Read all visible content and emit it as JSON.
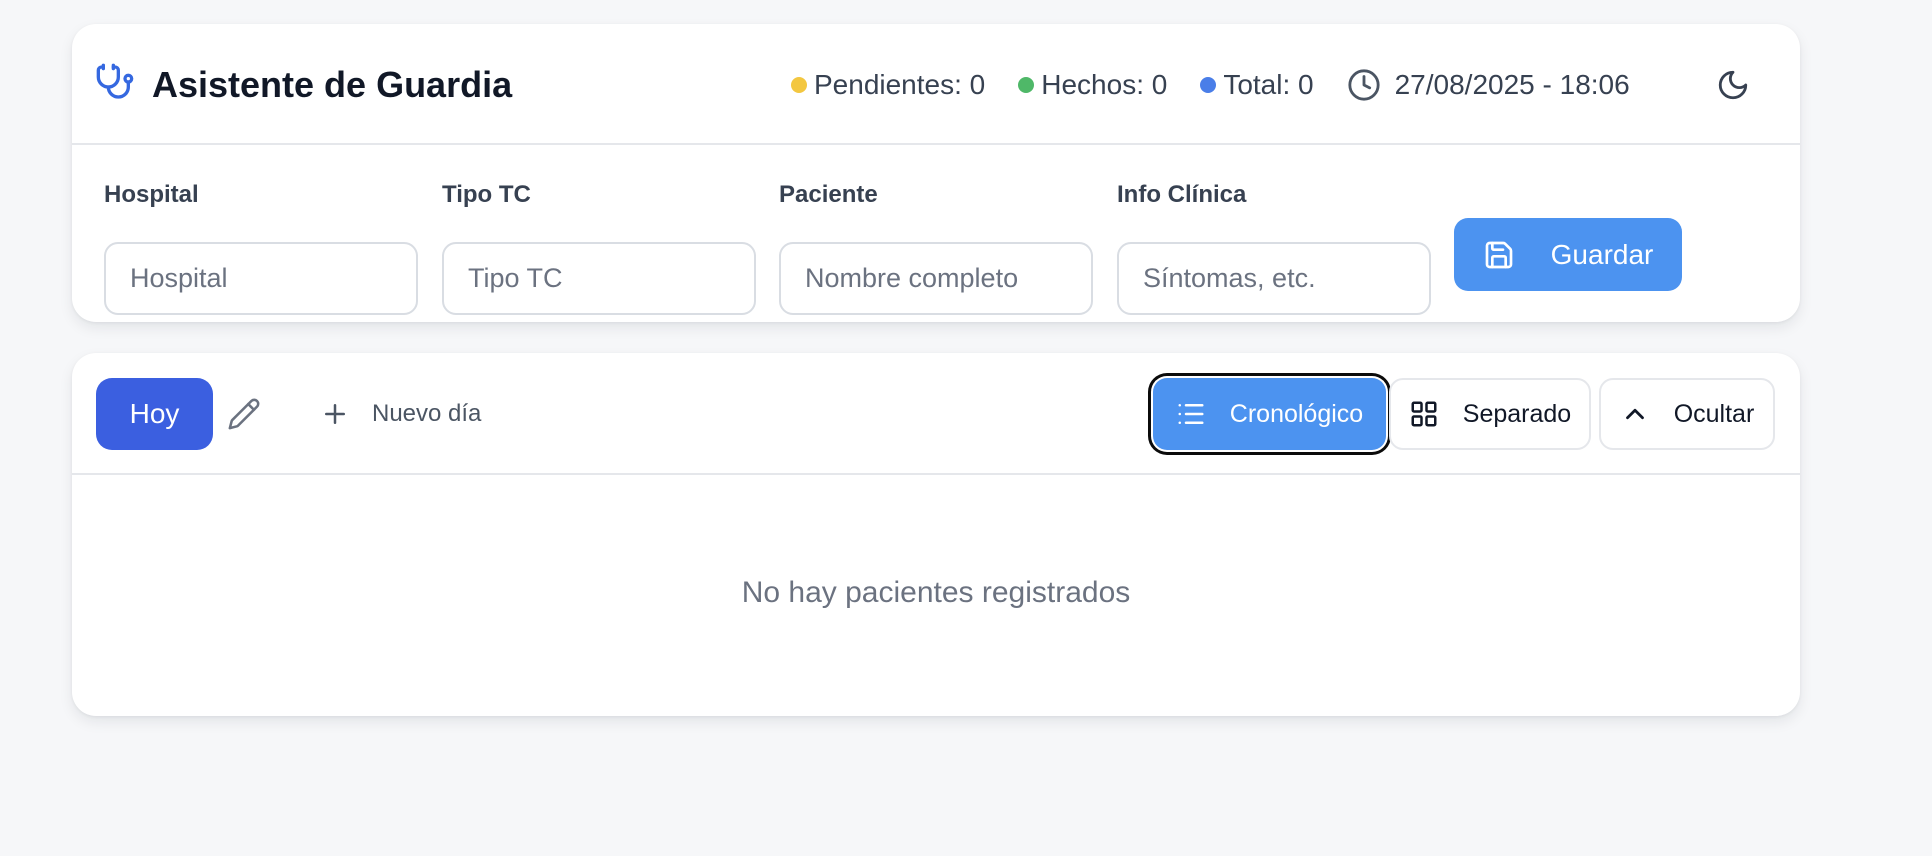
{
  "header": {
    "title": "Asistente de Guardia",
    "stats": {
      "pending": "Pendientes: 0",
      "done": "Hechos: 0",
      "total": "Total: 0"
    },
    "datetime": "27/08/2025 - 18:06",
    "colors": {
      "pending_dot": "#f3c740",
      "done_dot": "#4fb868",
      "total_dot": "#4a7ee8"
    }
  },
  "form": {
    "hospital": {
      "label": "Hospital",
      "placeholder": "Hospital",
      "value": ""
    },
    "tipo_tc": {
      "label": "Tipo TC",
      "placeholder": "Tipo TC",
      "value": ""
    },
    "paciente": {
      "label": "Paciente",
      "placeholder": "Nombre completo",
      "value": ""
    },
    "info_clinica": {
      "label": "Info Clínica",
      "placeholder": "Síntomas, etc.",
      "value": ""
    },
    "save_label": "Guardar"
  },
  "toolbar": {
    "today_label": "Hoy",
    "new_day_label": "Nuevo día",
    "views": {
      "chronological": "Cronológico",
      "separated": "Separado",
      "hide": "Ocultar"
    },
    "active_view": "chronological"
  },
  "list": {
    "empty_message": "No hay pacientes registrados"
  },
  "icons": [
    "stethoscope-icon",
    "clock-icon",
    "moon-icon",
    "save-icon",
    "pencil-icon",
    "plus-icon",
    "list-icon",
    "grid-icon",
    "chevron-up-icon"
  ],
  "accent_colors": {
    "primary": "#4c93f0",
    "today": "#3b5fe0"
  }
}
